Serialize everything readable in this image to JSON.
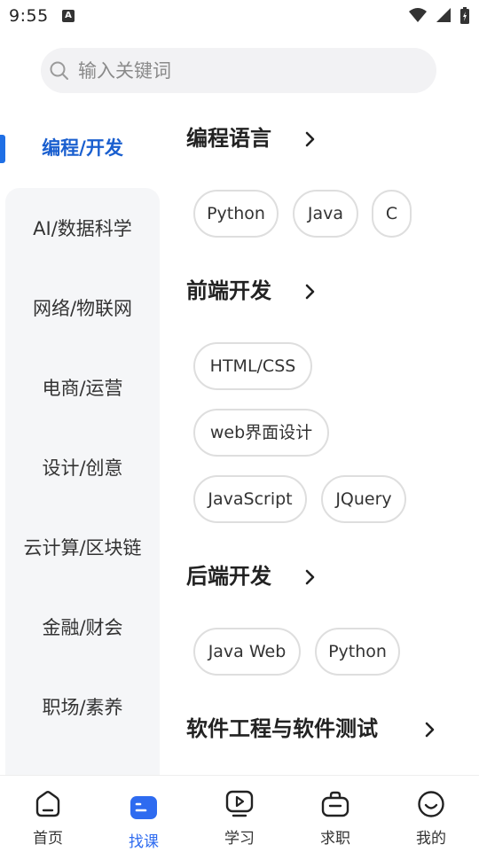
{
  "status": {
    "time": "9:55",
    "a_badge": "A"
  },
  "search": {
    "placeholder": "输入关键词"
  },
  "sidebar": {
    "items": [
      {
        "label": "编程/开发",
        "active": true
      },
      {
        "label": "AI/数据科学"
      },
      {
        "label": "网络/物联网"
      },
      {
        "label": "电商/运营"
      },
      {
        "label": "设计/创意"
      },
      {
        "label": "云计算/区块链"
      },
      {
        "label": "金融/财会"
      },
      {
        "label": "职场/素养"
      }
    ]
  },
  "content": {
    "sections": [
      {
        "title": "编程语言",
        "tags": [
          "Python",
          "Java",
          "C"
        ]
      },
      {
        "title": "前端开发",
        "tags": [
          "HTML/CSS",
          "web界面设计",
          "JavaScript",
          "JQuery"
        ]
      },
      {
        "title": "后端开发",
        "tags": [
          "Java Web",
          "Python"
        ]
      },
      {
        "title": "软件工程与软件测试",
        "tags": []
      }
    ]
  },
  "bottom_nav": {
    "items": [
      {
        "label": "首页",
        "icon": "home-icon"
      },
      {
        "label": "找课",
        "icon": "find-course-icon",
        "active": true
      },
      {
        "label": "学习",
        "icon": "study-icon"
      },
      {
        "label": "求职",
        "icon": "briefcase-icon"
      },
      {
        "label": "我的",
        "icon": "profile-icon"
      }
    ]
  },
  "colors": {
    "accent": "#1f6fe5",
    "sidebar_bg": "#f5f6f8",
    "search_bg": "#f2f2f4"
  }
}
